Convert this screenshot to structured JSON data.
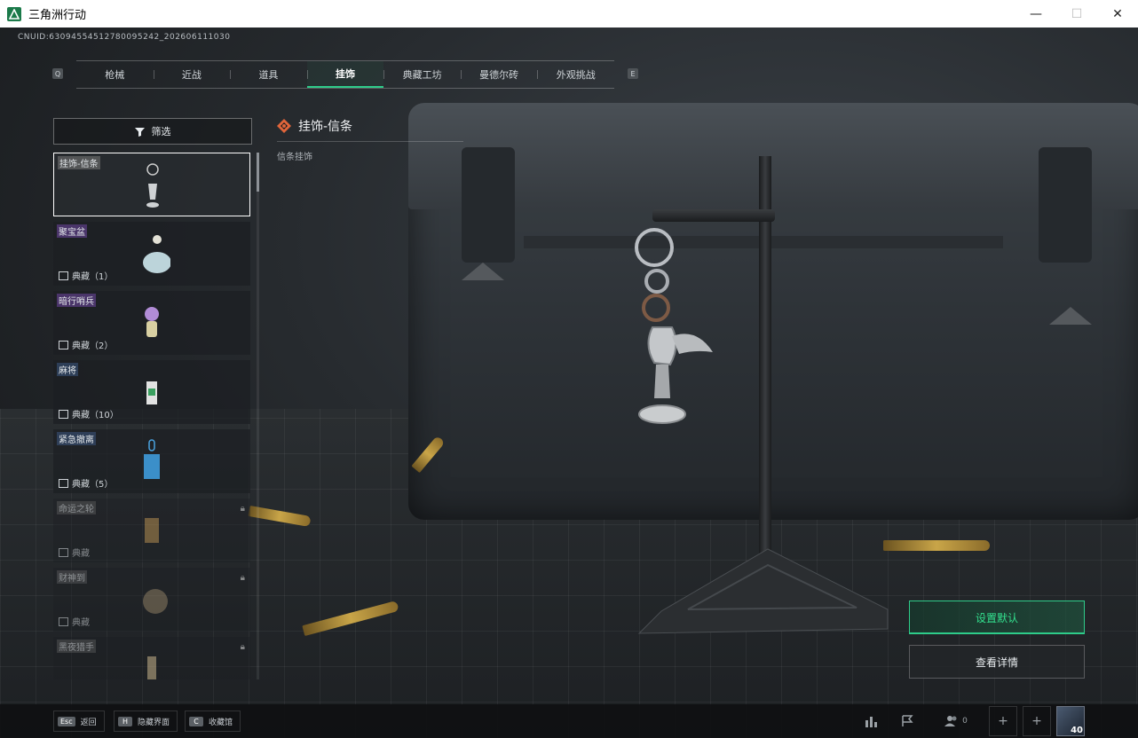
{
  "window": {
    "title": "三角洲行动",
    "controls": {
      "minimize": "—",
      "maximize": "☐",
      "close": "✕"
    }
  },
  "uid": "CNUID:63094554512780095242_202606111030",
  "tabs": {
    "prev_key": "Q",
    "next_key": "E",
    "items": [
      {
        "label": "枪械"
      },
      {
        "label": "近战"
      },
      {
        "label": "道具"
      },
      {
        "label": "挂饰",
        "active": true
      },
      {
        "label": "典藏工坊"
      },
      {
        "label": "曼德尔砖"
      },
      {
        "label": "外观挑战"
      }
    ]
  },
  "filter": {
    "label": "筛选"
  },
  "items": [
    {
      "name": "挂饰-信条",
      "collection": "",
      "tag": "white",
      "selected": true,
      "locked": false
    },
    {
      "name": "聚宝盆",
      "collection": "典藏（1）",
      "tag": "purple",
      "locked": false
    },
    {
      "name": "暗行哨兵",
      "collection": "典藏（2）",
      "tag": "purple",
      "locked": false
    },
    {
      "name": "麻将",
      "collection": "典藏（10）",
      "tag": "blue",
      "locked": false
    },
    {
      "name": "紧急撤离",
      "collection": "典藏（5）",
      "tag": "blue",
      "locked": false
    },
    {
      "name": "命运之轮",
      "collection": "典藏",
      "tag": "white",
      "locked": true
    },
    {
      "name": "财神到",
      "collection": "典藏",
      "tag": "white",
      "locked": true
    },
    {
      "name": "黑夜猎手",
      "collection": "",
      "tag": "white",
      "locked": true
    }
  ],
  "detail": {
    "title": "挂饰-信条",
    "subtitle": "信条挂饰"
  },
  "actions": {
    "set_default": "设置默认",
    "view_detail": "查看详情"
  },
  "bottom": {
    "hints": [
      {
        "key": "Esc",
        "label": "返回"
      },
      {
        "key": "H",
        "label": "隐藏界面"
      },
      {
        "key": "C",
        "label": "收藏馆"
      }
    ],
    "friends_count": "0",
    "level": "40"
  },
  "colors": {
    "accent": "#2ecc8a",
    "selected_border": "#ffffff"
  }
}
